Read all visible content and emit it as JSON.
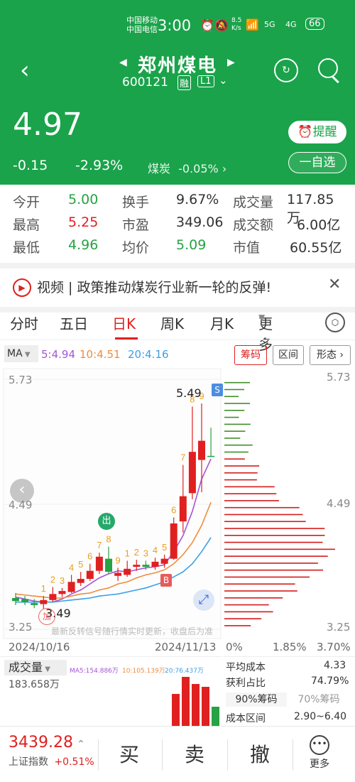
{
  "status": {
    "carrier1": "中国移动",
    "carrier2": "中国电信",
    "time": "3:00",
    "net_speed1": "8.5",
    "net_speed2": "K/s",
    "sig1": "5G",
    "sig2": "4G",
    "battery": "66"
  },
  "header": {
    "stock_name": "郑州煤电",
    "stock_code": "600121",
    "margin_tag": "融",
    "level_tag": "L1"
  },
  "price": {
    "last": "4.97",
    "change": "-0.15",
    "change_pct": "-2.93%",
    "sector": "煤炭",
    "sector_pct": "-0.05%",
    "remind_label": "提醒",
    "watch_label": "一自选"
  },
  "quote": [
    {
      "k1": "今开",
      "v1": "5.00",
      "k2": "换手",
      "v2": "9.67%",
      "k3": "成交量",
      "v3": "117.85万"
    },
    {
      "k1": "最高",
      "v1": "5.25",
      "k2": "市盈",
      "v2": "349.06",
      "k3": "成交额",
      "v3": "6.00亿"
    },
    {
      "k1": "最低",
      "v1": "4.96",
      "k2": "均价",
      "v2": "5.09",
      "k3": "市值",
      "v3": "60.55亿"
    }
  ],
  "news": {
    "text": "视频 | 政策推动煤炭行业新一轮的反弹!"
  },
  "tabs": [
    "分时",
    "五日",
    "日K",
    "周K",
    "月K",
    "更多"
  ],
  "ma": {
    "label": "MA",
    "ma5": "5:4.94",
    "ma10": "10:4.51",
    "ma20": "20:4.16"
  },
  "chart_buttons": [
    "筹码",
    "区间",
    "形态"
  ],
  "chart_notice": "最新反转信号随行情实时更新，收盘后为准",
  "chart_data": {
    "type": "candlestick",
    "y_ticks": [
      "5.73",
      "4.49",
      "3.25"
    ],
    "x_labels": [
      "2024/10/16",
      "2024/11/13"
    ],
    "high_label": "5.49",
    "low_label": "3.49",
    "ylim": [
      3.25,
      5.73
    ],
    "candles": [
      {
        "o": 3.53,
        "c": 3.56,
        "h": 3.61,
        "l": 3.49,
        "up": false
      },
      {
        "o": 3.55,
        "c": 3.52,
        "h": 3.58,
        "l": 3.49,
        "up": false
      },
      {
        "o": 3.49,
        "c": 3.51,
        "h": 3.55,
        "l": 3.46,
        "up": false
      },
      {
        "o": 3.5,
        "c": 3.54,
        "h": 3.58,
        "l": 3.45,
        "up": true
      },
      {
        "o": 3.54,
        "c": 3.6,
        "h": 3.67,
        "l": 3.52,
        "up": true
      },
      {
        "o": 3.6,
        "c": 3.63,
        "h": 3.66,
        "l": 3.57,
        "up": true
      },
      {
        "o": 3.62,
        "c": 3.72,
        "h": 3.79,
        "l": 3.61,
        "up": true
      },
      {
        "o": 3.71,
        "c": 3.75,
        "h": 3.82,
        "l": 3.68,
        "up": true
      },
      {
        "o": 3.75,
        "c": 3.83,
        "h": 3.9,
        "l": 3.73,
        "up": true
      },
      {
        "o": 3.83,
        "c": 3.97,
        "h": 4.01,
        "l": 3.8,
        "up": true
      },
      {
        "o": 3.95,
        "c": 3.82,
        "h": 4.07,
        "l": 3.8,
        "up": false
      },
      {
        "o": 3.81,
        "c": 3.78,
        "h": 3.86,
        "l": 3.73,
        "up": true
      },
      {
        "o": 3.79,
        "c": 3.85,
        "h": 3.93,
        "l": 3.77,
        "up": true
      },
      {
        "o": 3.87,
        "c": 3.89,
        "h": 3.94,
        "l": 3.83,
        "up": true
      },
      {
        "o": 3.87,
        "c": 3.89,
        "h": 3.93,
        "l": 3.84,
        "up": false
      },
      {
        "o": 3.87,
        "c": 3.92,
        "h": 3.96,
        "l": 3.84,
        "up": true
      },
      {
        "o": 3.9,
        "c": 3.95,
        "h": 3.99,
        "l": 3.86,
        "up": true
      },
      {
        "o": 3.95,
        "c": 4.3,
        "h": 4.36,
        "l": 3.94,
        "up": true
      },
      {
        "o": 4.32,
        "c": 4.57,
        "h": 4.88,
        "l": 4.21,
        "up": true
      },
      {
        "o": 4.6,
        "c": 5.01,
        "h": 5.46,
        "l": 4.54,
        "up": true
      },
      {
        "o": 4.93,
        "c": 5.12,
        "h": 5.49,
        "l": 4.61,
        "up": true
      },
      {
        "o": 4.97,
        "c": 4.97,
        "h": 5.25,
        "l": 4.96,
        "up": false
      }
    ],
    "ma_series": [
      {
        "name": "MA5",
        "color": "#a555d8",
        "values": [
          3.57,
          3.55,
          3.53,
          3.52,
          3.52,
          3.55,
          3.6,
          3.64,
          3.7,
          3.76,
          3.8,
          3.83,
          3.82,
          3.84,
          3.86,
          3.87,
          3.89,
          4.02,
          4.18,
          4.42,
          4.74,
          4.94
        ]
      },
      {
        "name": "MA10",
        "color": "#f08c3c",
        "values": [
          3.6,
          3.59,
          3.58,
          3.57,
          3.56,
          3.56,
          3.58,
          3.6,
          3.61,
          3.64,
          3.66,
          3.7,
          3.72,
          3.76,
          3.79,
          3.81,
          3.84,
          3.9,
          3.99,
          4.11,
          4.28,
          4.51
        ]
      },
      {
        "name": "MA20",
        "color": "#39a0e8",
        "values": [
          3.52,
          3.52,
          3.52,
          3.52,
          3.52,
          3.53,
          3.54,
          3.55,
          3.56,
          3.58,
          3.59,
          3.6,
          3.62,
          3.64,
          3.66,
          3.69,
          3.72,
          3.77,
          3.82,
          3.9,
          4.02,
          4.16
        ]
      }
    ],
    "signal_labels": [
      "1",
      "2",
      "3",
      "4",
      "5",
      "6",
      "7",
      "8",
      "9",
      "1",
      "2",
      "3",
      "4",
      "5",
      "6",
      "7",
      "8",
      "9"
    ],
    "distribution": {
      "x_ticks": [
        "0%",
        "1.85%",
        "3.70%"
      ],
      "avg_cost_label": "平均成本",
      "avg_cost": "4.33",
      "profit_label": "获利占比",
      "profit": "74.79%",
      "chip90": "90%筹码",
      "chip70": "70%筹码",
      "range_label": "成本区间",
      "range": "2.90~6.40"
    }
  },
  "volume": {
    "label": "成交量",
    "value": "183.658万",
    "ma5": "MA5:154.886万",
    "ma10": "10:105.139万",
    "ma20": "20:76.437万"
  },
  "index": {
    "value": "3439.28",
    "name": "上证指数",
    "pct": "+0.51%"
  },
  "actions": {
    "buy": "买",
    "sell": "卖",
    "cancel": "撤",
    "more": "更多"
  }
}
